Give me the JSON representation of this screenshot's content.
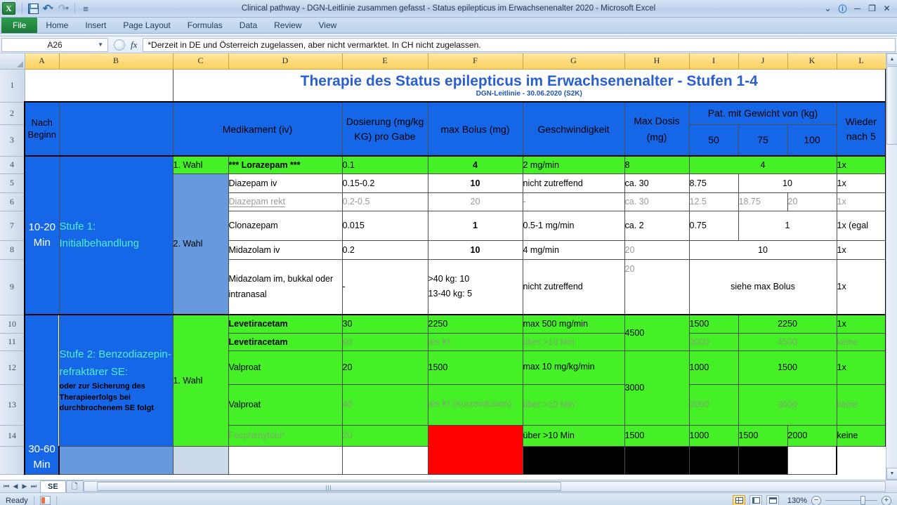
{
  "window": {
    "title": "Clinical pathway - DGN-Leitlinie zusammen gefasst - Status epilepticus im Erwachsenenalter 2020  -  Microsoft Excel",
    "minimize": "─",
    "restore": "❐",
    "close": "✕",
    "help": "?",
    "ribbon_toggle": "⌄"
  },
  "qat": {
    "save": "save-icon",
    "undo": "↶",
    "redo": "↷",
    "customize": "≡"
  },
  "ribbon": {
    "tabs": [
      {
        "label": "File"
      },
      {
        "label": "Home"
      },
      {
        "label": "Insert"
      },
      {
        "label": "Page Layout"
      },
      {
        "label": "Formulas"
      },
      {
        "label": "Data"
      },
      {
        "label": "Review"
      },
      {
        "label": "View"
      }
    ]
  },
  "formula_bar": {
    "name_box": "A26",
    "fx_label": "fx",
    "formula": "*Derzeit in DE und Österreich zugelassen, aber nicht vermarktet. In CH nicht zugelassen."
  },
  "grid": {
    "column_headers": [
      "A",
      "B",
      "C",
      "D",
      "E",
      "F",
      "G",
      "H",
      "I",
      "J",
      "K",
      "L"
    ],
    "row_headers": [
      "1",
      "2",
      "3",
      "4",
      "5",
      "6",
      "7",
      "8",
      "9",
      "10",
      "11",
      "12",
      "13",
      "14"
    ]
  },
  "sheet": {
    "title": "Therapie des Status epilepticus im Erwachsenenalter - Stufen 1-4",
    "subtitle": "DGN-Leitlinie - 30.06.2020 (S2K)",
    "headers": {
      "col_a": "Nach Beginn",
      "col_d": "Medikament (iv)",
      "col_e": "Dosierung (mg/kg KG) pro Gabe",
      "col_f": "max Bolus (mg)",
      "col_g": "Geschwindigkeit",
      "col_h": "Max Dosis (mg)",
      "col_weight_group": "Pat. mit Gewicht von (kg)",
      "col_i": "50",
      "col_j": "75",
      "col_k": "100",
      "col_l": "Wieder nach 5"
    },
    "stufe1": {
      "time": "10-20 Min",
      "label": "Stufe 1: Initialbehandlung",
      "choice1": "1. Wahl",
      "choice2": "2. Wahl"
    },
    "stufe2": {
      "time": "30-60 Min",
      "label_main": "Stufe 2: Benzodiazepin-refraktärer SE:",
      "label_sub": "oder zur Sicherung des Therapieerfolgs bei durchbrochenem SE folgt",
      "choice1": "1. Wahl"
    },
    "rows": [
      {
        "row": "4",
        "drug": "*** Lorazepam ***",
        "dose": "0.1",
        "bolus": "4",
        "speed": "2 mg/min",
        "maxdose": "8",
        "w50": "4",
        "w75": "",
        "w100": "",
        "repeat": "1x"
      },
      {
        "row": "5",
        "drug": "Diazepam iv",
        "dose": "0.15-0.2",
        "bolus": "10",
        "speed": "nicht zutreffend",
        "maxdose": "ca. 30",
        "w50": "8.75",
        "w75": "10",
        "w100": "",
        "repeat": "1x"
      },
      {
        "row": "6",
        "drug": "Diazepam rekt",
        "dose": "0.2-0.5",
        "bolus": "20",
        "speed": "-",
        "maxdose": "ca. 30",
        "w50": "12.5",
        "w75": "18.75",
        "w100": "20",
        "repeat": "1x"
      },
      {
        "row": "7",
        "drug": "Clonazepam",
        "dose": "0.015",
        "bolus": "1",
        "speed": "0.5-1 mg/min",
        "maxdose": "ca. 2",
        "w50": "0.75",
        "w75": "1",
        "w100": "",
        "repeat": "1x (egal"
      },
      {
        "row": "8",
        "drug": "Midazolam iv",
        "dose": "0.2",
        "bolus": "10",
        "speed": "4 mg/min",
        "maxdose": "20",
        "w50": "10",
        "w75": "",
        "w100": "",
        "repeat": "1x"
      },
      {
        "row": "9",
        "drug": "Midazolam im, bukkal oder intranasal",
        "dose": "-",
        "bolus": ">40 kg: 10\n13-40 kg: 5",
        "speed": "nicht zutreffend",
        "maxdose": "20",
        "w50": "siehe max Bolus",
        "w75": "",
        "w100": "",
        "repeat": "1x"
      },
      {
        "row": "10",
        "drug": "Levetiracetam",
        "dose": "30",
        "bolus": "2250",
        "speed": "max 500 mg/min",
        "maxdose": "4500",
        "w50": "1500",
        "w75": "2250",
        "w100": "",
        "repeat": "1x"
      },
      {
        "row": "11",
        "drug": "Levetiracetam",
        "dose": "60",
        "bolus": "als KI",
        "speed": "über >10 Min",
        "maxdose": "",
        "w50": "3000",
        "w75": "4500",
        "w100": "",
        "repeat": "keine"
      },
      {
        "row": "12",
        "drug": "Valproat",
        "dose": "20",
        "bolus": "1500",
        "speed": "max 10 mg/kg/min",
        "maxdose": "3000",
        "w50": "1000",
        "w75": "1500",
        "w100": "",
        "repeat": "1x"
      },
      {
        "row": "13",
        "drug": "Valproat",
        "dose": "40",
        "bolus": "als KI (Kurzeinfusion)",
        "speed": "über >10 Min",
        "maxdose": "",
        "w50": "2000",
        "w75": "3000",
        "w100": "",
        "repeat": "keine"
      },
      {
        "row": "14",
        "drug": "Fosphenytoin*",
        "dose": "20",
        "bolus": "",
        "speed": "über >10 Min",
        "maxdose": "1500",
        "w50": "1000",
        "w75": "1500",
        "w100": "2000",
        "repeat": "keine"
      }
    ]
  },
  "sheet_tabs": {
    "first": "⏮",
    "prev": "◀",
    "next": "▶",
    "last": "⏭",
    "tabs": [
      {
        "label": "SE",
        "active": true
      }
    ],
    "new_sheet": "❐"
  },
  "status_bar": {
    "state": "Ready",
    "zoom": "130%",
    "zoom_out": "−",
    "zoom_in": "+",
    "views": [
      "normal-view",
      "page-layout-view",
      "page-break-view"
    ]
  }
}
